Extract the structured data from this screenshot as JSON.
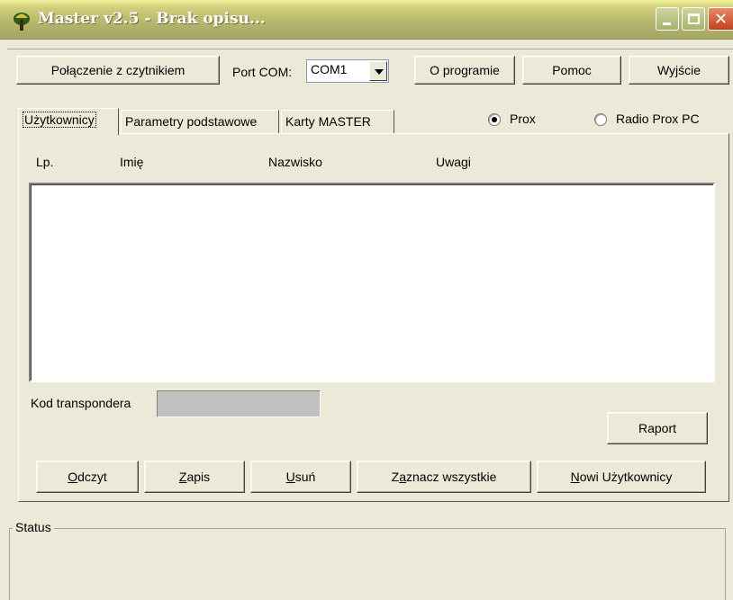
{
  "window": {
    "title": "Master v2.5 - Brak opisu..."
  },
  "toolbar": {
    "connect_label": "Połączenie z czytnikiem",
    "port_label": "Port COM:",
    "port_value": "COM1",
    "about_label": "O programie",
    "help_label": "Pomoc",
    "exit_label": "Wyjście"
  },
  "tabs": [
    {
      "label": "Użytkownicy",
      "active": true
    },
    {
      "label": "Parametry podstawowe",
      "active": false
    },
    {
      "label": "Karty MASTER",
      "active": false
    }
  ],
  "mode": {
    "prox_label": "Prox",
    "prox_selected": true,
    "radio_prox_label": "Radio Prox PC",
    "radio_prox_selected": false
  },
  "list": {
    "columns": [
      "Lp.",
      "Imię",
      "Nazwisko",
      "Uwagi"
    ],
    "rows": []
  },
  "transponder": {
    "label": "Kod transpondera",
    "value": ""
  },
  "actions": {
    "report_label": "Raport",
    "read_first": "O",
    "read_rest": "dczyt",
    "write_first": "Z",
    "write_rest": "apis",
    "delete_first": "U",
    "delete_rest": "suń",
    "select_all_pre": "Z",
    "select_all_acc": "a",
    "select_all_rest": "znacz wszystkie",
    "new_users_first": "N",
    "new_users_rest": "owi Użytkownicy"
  },
  "status": {
    "label": "Status",
    "text": ""
  },
  "colors": {
    "face": "#ece9d8",
    "title_bar": "#b8b86d",
    "close_button": "#c2401f"
  }
}
